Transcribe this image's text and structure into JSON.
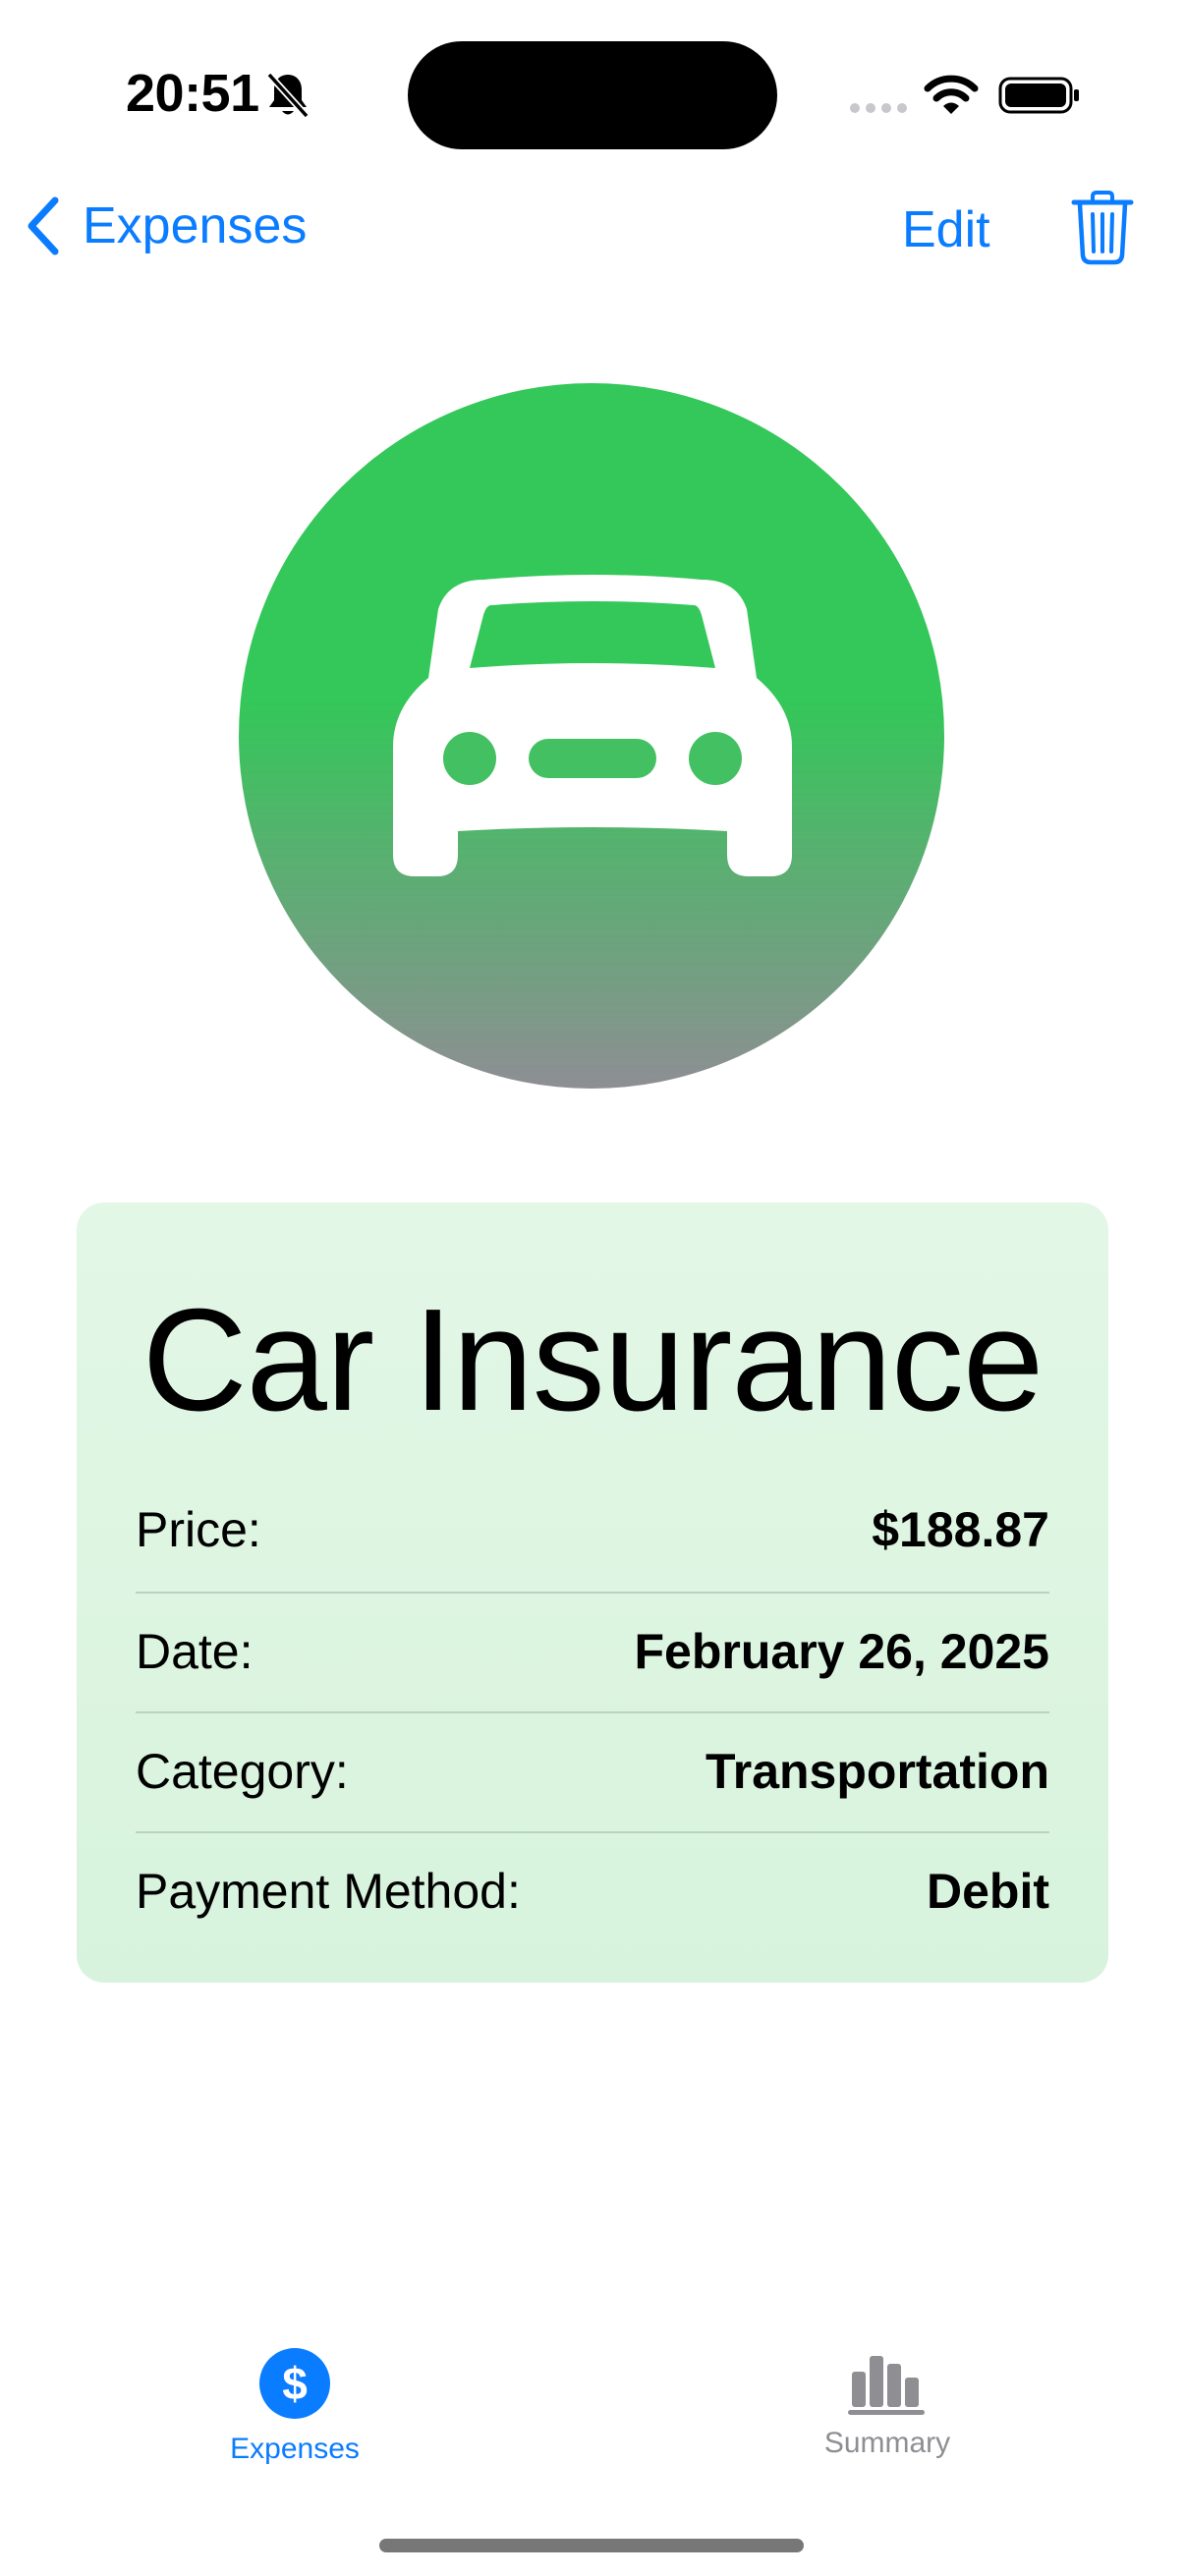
{
  "status_bar": {
    "time": "20:51"
  },
  "nav": {
    "back_label": "Expenses",
    "edit_label": "Edit"
  },
  "hero": {
    "icon": "car-icon",
    "colors": {
      "top": "#34c759",
      "bottom": "#8e8e93"
    }
  },
  "expense": {
    "title": "Car Insurance",
    "rows": [
      {
        "label": "Price:",
        "value": "$188.87"
      },
      {
        "label": "Date:",
        "value": "February 26, 2025"
      },
      {
        "label": "Category:",
        "value": "Transportation"
      },
      {
        "label": "Payment Method:",
        "value": "Debit"
      }
    ]
  },
  "tabs": [
    {
      "label": "Expenses",
      "icon": "dollar-icon",
      "selected": true
    },
    {
      "label": "Summary",
      "icon": "bar-chart-icon",
      "selected": false
    }
  ],
  "colors": {
    "accent": "#0a7cff",
    "card_bg": "#dcf5e1",
    "inactive": "#8e8e93"
  }
}
